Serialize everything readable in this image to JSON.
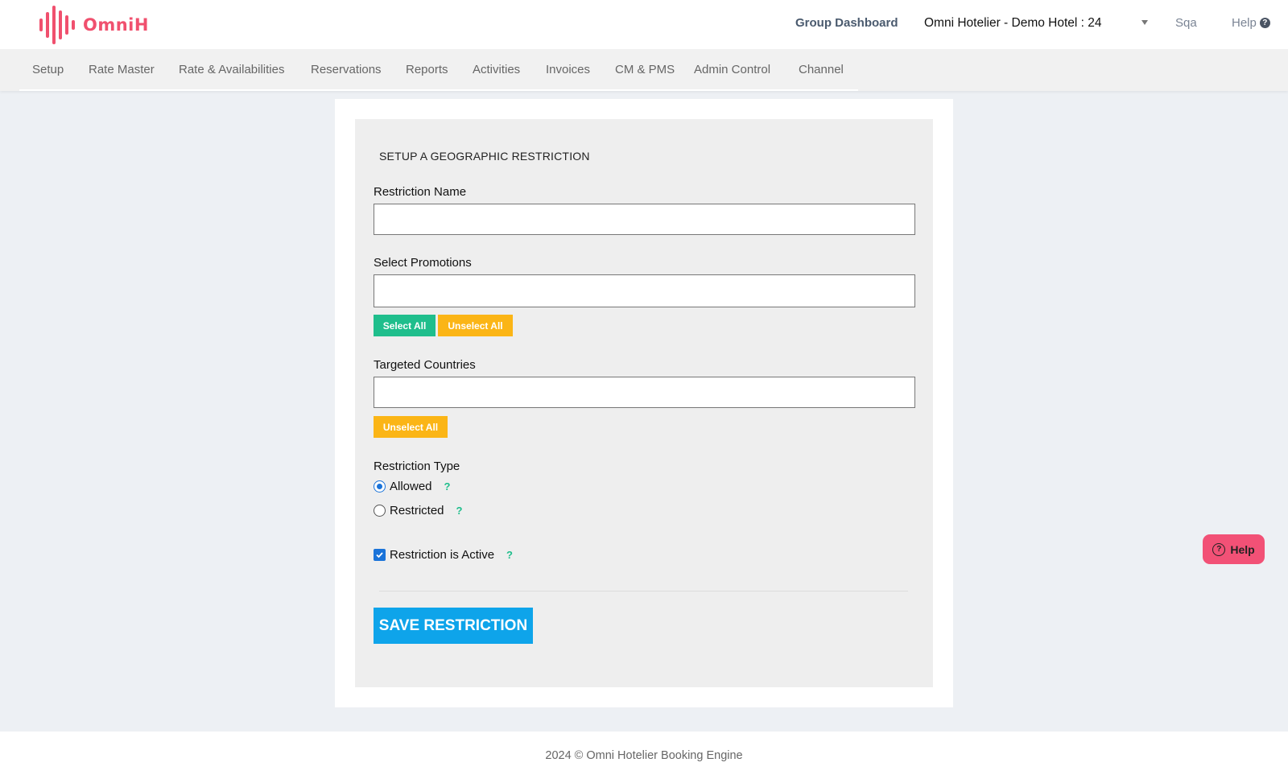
{
  "brand": {
    "name": "OmniH",
    "color": "#f0506e"
  },
  "header": {
    "group_dashboard": "Group Dashboard",
    "hotel_selected": "Omni Hotelier - Demo Hotel : 24",
    "user": "Sqa",
    "help": "Help"
  },
  "nav": {
    "items": [
      "Setup",
      "Rate Master",
      "Rate & Availabilities",
      "Reservations",
      "Reports",
      "Activities",
      "Invoices",
      "CM & PMS",
      "Admin Control",
      "Channel"
    ]
  },
  "form": {
    "title": "SETUP A GEOGRAPHIC RESTRICTION",
    "restriction_name_label": "Restriction Name",
    "restriction_name_value": "",
    "promotions_label": "Select Promotions",
    "promotions_value": "",
    "select_all": "Select All",
    "unselect_all": "Unselect All",
    "countries_label": "Targeted Countries",
    "countries_value": "",
    "countries_unselect_all": "Unselect All",
    "type_label": "Restriction Type",
    "type_allowed": "Allowed",
    "type_restricted": "Restricted",
    "type_selected": "Allowed",
    "tooltip_glyph": "?",
    "active_label": "Restriction is Active",
    "active_checked": true,
    "save_button": "SAVE RESTRICTION"
  },
  "float_help": {
    "label": "Help"
  },
  "footer": {
    "text": "2024 © Omni Hotelier Booking Engine"
  },
  "colors": {
    "green": "#1fbe8c",
    "yellow": "#fbb516",
    "blue": "#0ea4ea",
    "pink": "#f25176"
  }
}
